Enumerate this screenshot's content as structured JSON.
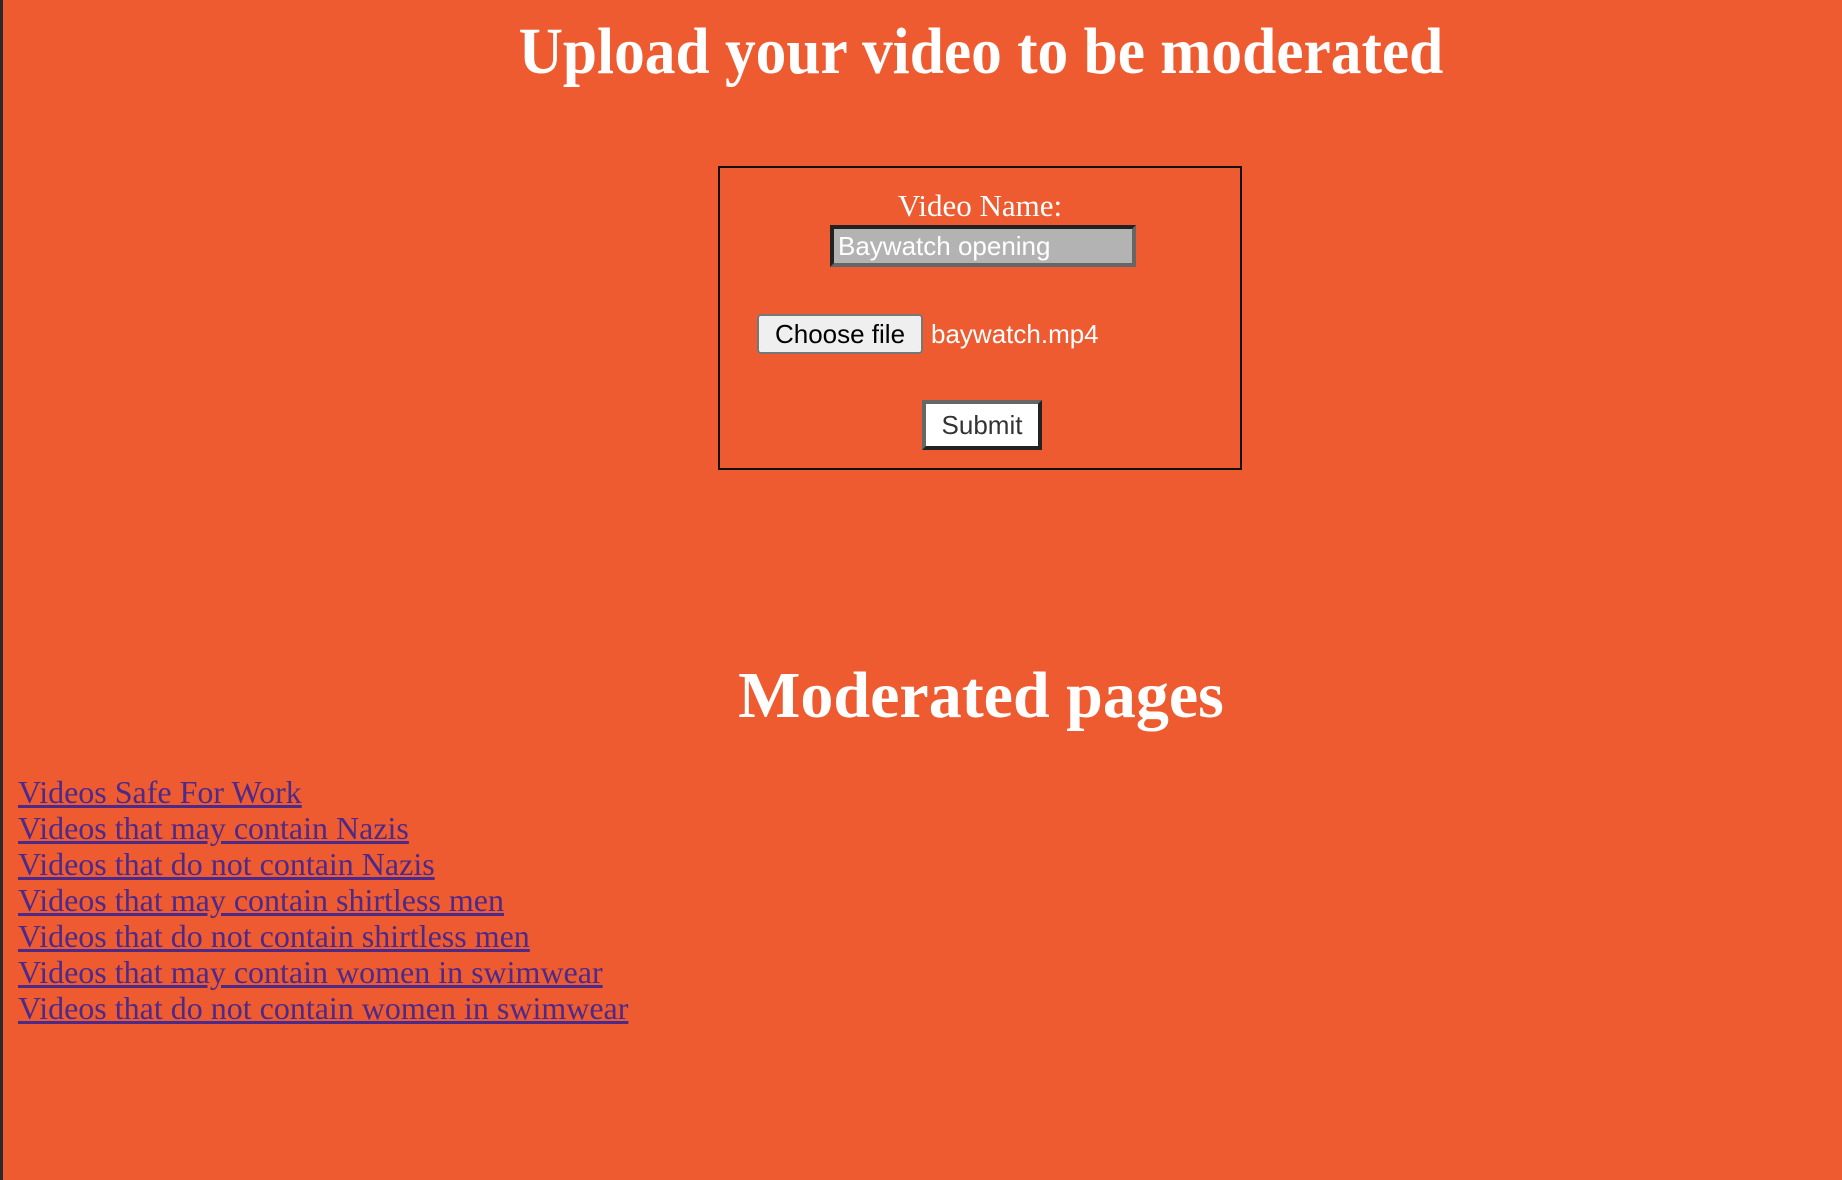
{
  "colors": {
    "background": "#EF5B30",
    "link": "#4B2A8A",
    "heading": "#ffffff"
  },
  "upload": {
    "title": "Upload your video to be moderated",
    "form": {
      "name_label": "Video Name:",
      "name_value": "Baywatch opening",
      "choose_file_label": "Choose file",
      "chosen_file_name": "baywatch.mp4",
      "submit_label": "Submit"
    }
  },
  "moderated": {
    "title": "Moderated pages",
    "links": [
      "Videos Safe For Work",
      "Videos that may contain Nazis",
      "Videos that do not contain Nazis",
      "Videos that may contain shirtless men",
      "Videos that do not contain shirtless men",
      "Videos that may contain women in swimwear",
      "Videos that do not contain women in swimwear"
    ]
  }
}
